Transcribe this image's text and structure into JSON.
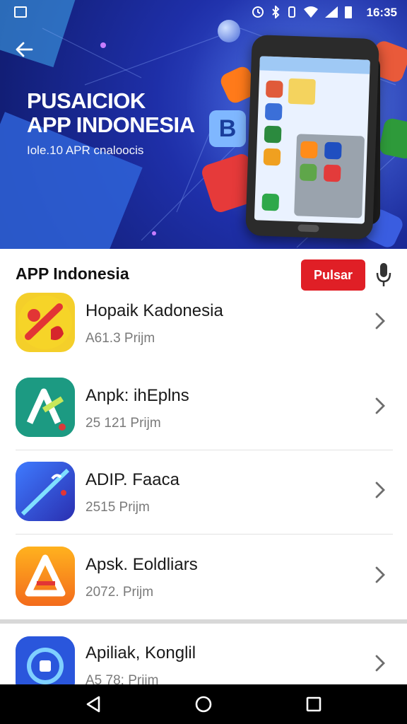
{
  "status_bar": {
    "time": "16:35"
  },
  "hero": {
    "title_line1": "PUSAICIOK",
    "title_line2": "APP INDONESIA",
    "subtitle": "Iole.10 APR cnaloocis",
    "badge_letter": "B"
  },
  "section": {
    "title": "APP Indonesia",
    "button_label": "Pulsar"
  },
  "apps": [
    {
      "name": "Hopaik Kadonesia",
      "meta": "A61.3 Prijm",
      "icon": "red-percent-yellow-icon"
    },
    {
      "name": "Anpk: ihEplns",
      "meta": "25 121 Prijm",
      "icon": "teal-a-icon"
    },
    {
      "name": "ADIP. Faaca",
      "meta": "2515 Prijm",
      "icon": "blue-brush-icon"
    },
    {
      "name": "Apsk. Eoldliars",
      "meta": "2072. Prijm",
      "icon": "orange-a-icon"
    },
    {
      "name": "Apiliak, Konglil",
      "meta": "A5 78: Prijm",
      "icon": "blue-ring-icon"
    }
  ],
  "colors": {
    "accent_red": "#e01f26",
    "hero_blue": "#1e2fa8"
  }
}
